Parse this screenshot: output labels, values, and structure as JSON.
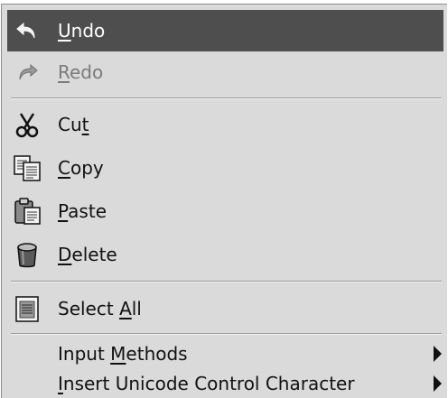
{
  "menu": {
    "items": [
      {
        "pre": "",
        "u": "U",
        "post": "ndo",
        "icon": "undo-icon",
        "state": "highlighted"
      },
      {
        "pre": "",
        "u": "R",
        "post": "edo",
        "icon": "redo-icon",
        "state": "disabled"
      },
      {
        "pre": "Cu",
        "u": "t",
        "post": "",
        "icon": "scissors-icon",
        "state": "normal"
      },
      {
        "pre": "",
        "u": "C",
        "post": "opy",
        "icon": "copy-icon",
        "state": "normal"
      },
      {
        "pre": "",
        "u": "P",
        "post": "aste",
        "icon": "paste-icon",
        "state": "normal"
      },
      {
        "pre": "",
        "u": "D",
        "post": "elete",
        "icon": "trash-icon",
        "state": "normal"
      },
      {
        "pre": "Select ",
        "u": "A",
        "post": "ll",
        "icon": "select-all-icon",
        "state": "normal"
      },
      {
        "pre": "Input ",
        "u": "M",
        "post": "ethods",
        "icon": "",
        "submenu": true,
        "state": "normal"
      },
      {
        "pre": "",
        "u": "I",
        "post": "nsert Unicode Control Character",
        "icon": "",
        "submenu": true,
        "state": "normal"
      }
    ]
  },
  "colors": {
    "menu_background": "#dadada",
    "highlight_background": "#4e4e4e",
    "highlight_text": "#ffffff",
    "disabled_text": "#7b7b7b"
  }
}
